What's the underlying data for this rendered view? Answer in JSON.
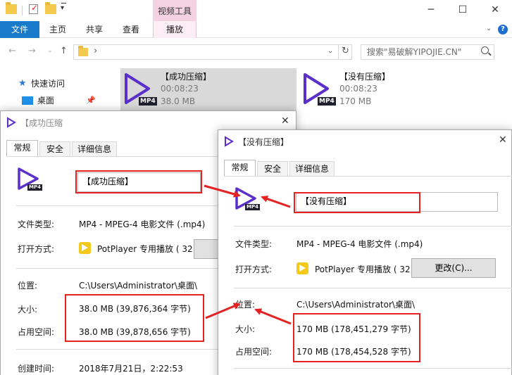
{
  "explorer": {
    "ribbon": {
      "context_group": "视频工具",
      "tabs": [
        "文件",
        "主页",
        "共享",
        "查看",
        "播放"
      ]
    },
    "address": {
      "chevron": "›"
    },
    "search": {
      "placeholder": "搜索\"易破解YIPOJIE.CN\""
    },
    "nav_pane": {
      "quick_access": "快速访问",
      "desktop": "桌面"
    },
    "files": [
      {
        "name": "【成功压缩】",
        "duration": "00:08:23",
        "size": "38.0 MB",
        "badge": "MP4"
      },
      {
        "name": "【没有压缩】",
        "duration": "00:08:23",
        "size": "170 MB",
        "badge": "MP4"
      }
    ]
  },
  "dialogs": [
    {
      "title": "【成功压缩",
      "tabs": [
        "常规",
        "安全",
        "详细信息"
      ],
      "filename": "【成功压缩】",
      "badge": "MP4",
      "labels": {
        "file_type": "文件类型:",
        "opens_with": "打开方式:",
        "location": "位置:",
        "size": "大小:",
        "size_on_disk": "占用空间:",
        "created": "创建时间:"
      },
      "values": {
        "file_type": "MP4 - MPEG-4 电影文件 (.mp4)",
        "opens_with": "PotPlayer 专用播放 ( 32",
        "location": "C:\\Users\\Administrator\\桌面\\",
        "size": "38.0 MB (39,876,364 字节)",
        "size_on_disk": "38.0 MB (39,878,656 字节)",
        "created": "2018年7月21日，2:22:53"
      }
    },
    {
      "title": "【没有压缩】",
      "tabs": [
        "常规",
        "安全",
        "详细信息"
      ],
      "filename": "【没有压缩】",
      "badge": "MP4",
      "change_button": "更改(C)...",
      "labels": {
        "file_type": "文件类型:",
        "opens_with": "打开方式:",
        "location": "位置:",
        "size": "大小:",
        "size_on_disk": "占用空间:"
      },
      "values": {
        "file_type": "MP4 - MPEG-4 电影文件 (.mp4)",
        "opens_with": "PotPlayer 专用播放 ( 32",
        "location": "C:\\Users\\Administrator\\桌面\\",
        "size": "170 MB (178,451,279 字节)",
        "size_on_disk": "170 MB (178,454,528 字节)"
      }
    }
  ],
  "colors": {
    "accent": "#1979ca",
    "annotation_red": "#e52222",
    "play_icon": "#5b2fc9",
    "context_tab": "#f4d2e4"
  }
}
